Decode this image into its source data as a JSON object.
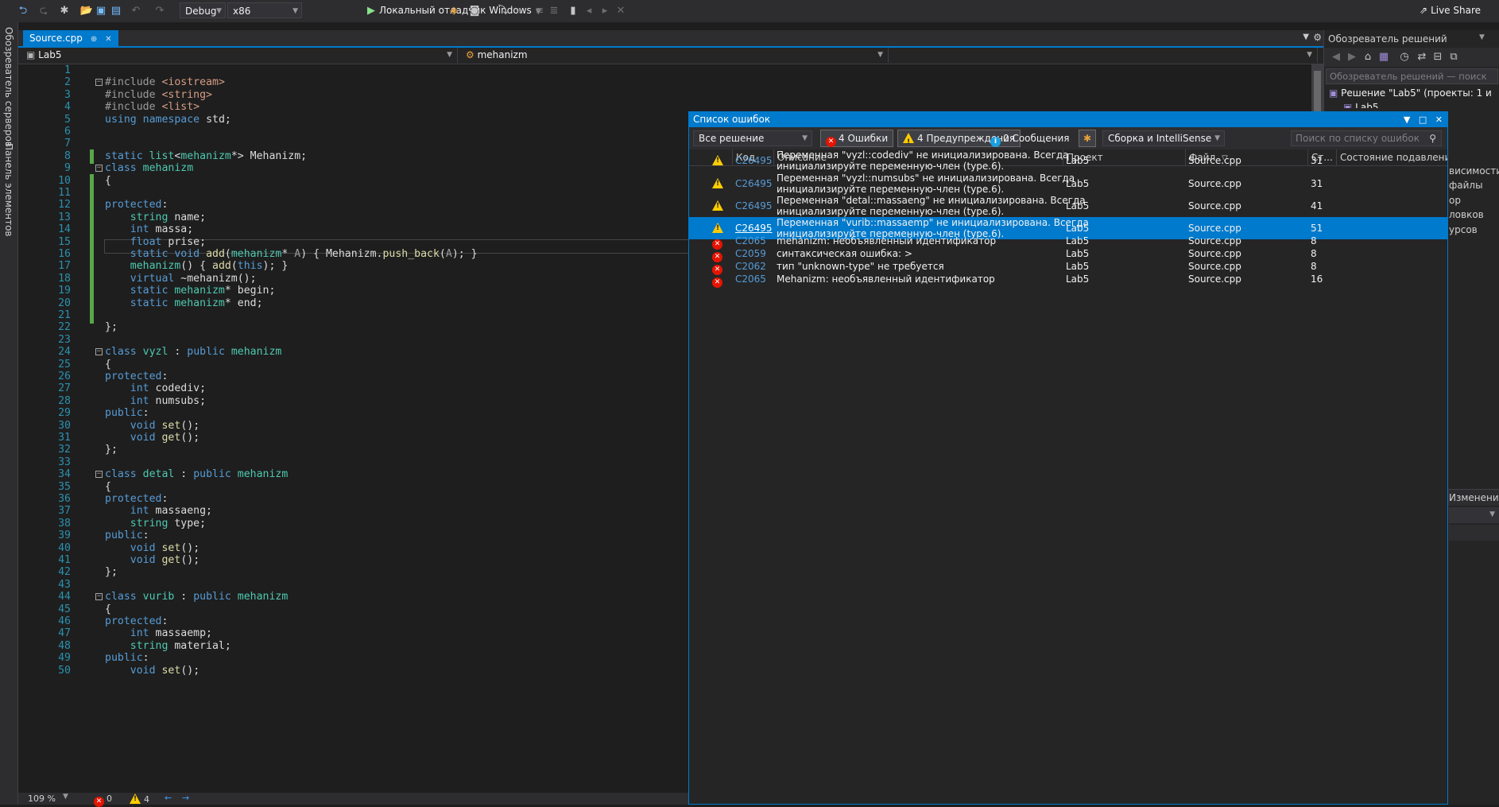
{
  "toolbar": {
    "configuration": "Debug",
    "platform": "x86",
    "run_label": "Локальный отладчик Windows",
    "live_share": "Live Share"
  },
  "left_strip": {
    "server_explorer": "Обозреватель серверов",
    "toolbox": "Панель элементов"
  },
  "editor": {
    "tab_title": "Source.cpp",
    "project_scope": "Lab5",
    "member_scope": "mehanizm",
    "zoom": "109 %",
    "error_count": "0",
    "warning_count": "4",
    "lines": [
      {
        "n": "1",
        "t": ""
      },
      {
        "n": "2",
        "t": "#include <iostream>"
      },
      {
        "n": "3",
        "t": "#include <string>"
      },
      {
        "n": "4",
        "t": "#include <list>"
      },
      {
        "n": "5",
        "t": "using namespace std;"
      },
      {
        "n": "6",
        "t": ""
      },
      {
        "n": "7",
        "t": ""
      },
      {
        "n": "8",
        "t": "static list<mehanizm*> Mehanizm;"
      },
      {
        "n": "9",
        "t": "class mehanizm"
      },
      {
        "n": "10",
        "t": "{"
      },
      {
        "n": "11",
        "t": ""
      },
      {
        "n": "12",
        "t": "protected:"
      },
      {
        "n": "13",
        "t": "    string name;"
      },
      {
        "n": "14",
        "t": "    int massa;"
      },
      {
        "n": "15",
        "t": "    float prise;"
      },
      {
        "n": "16",
        "t": "    static void add(mehanizm* A) { Mehanizm.push_back(A); }"
      },
      {
        "n": "17",
        "t": "    mehanizm() { add(this); }"
      },
      {
        "n": "18",
        "t": "    virtual ~mehanizm();"
      },
      {
        "n": "19",
        "t": "    static mehanizm* begin;"
      },
      {
        "n": "20",
        "t": "    static mehanizm* end;"
      },
      {
        "n": "21",
        "t": ""
      },
      {
        "n": "22",
        "t": "};"
      },
      {
        "n": "23",
        "t": ""
      },
      {
        "n": "24",
        "t": "class vyzl : public mehanizm"
      },
      {
        "n": "25",
        "t": "{"
      },
      {
        "n": "26",
        "t": "protected:"
      },
      {
        "n": "27",
        "t": "    int codediv;"
      },
      {
        "n": "28",
        "t": "    int numsubs;"
      },
      {
        "n": "29",
        "t": "public:"
      },
      {
        "n": "30",
        "t": "    void set();"
      },
      {
        "n": "31",
        "t": "    void get();"
      },
      {
        "n": "32",
        "t": "};"
      },
      {
        "n": "33",
        "t": ""
      },
      {
        "n": "34",
        "t": "class detal : public mehanizm"
      },
      {
        "n": "35",
        "t": "{"
      },
      {
        "n": "36",
        "t": "protected:"
      },
      {
        "n": "37",
        "t": "    int massaeng;"
      },
      {
        "n": "38",
        "t": "    string type;"
      },
      {
        "n": "39",
        "t": "public:"
      },
      {
        "n": "40",
        "t": "    void set();"
      },
      {
        "n": "41",
        "t": "    void get();"
      },
      {
        "n": "42",
        "t": "};"
      },
      {
        "n": "43",
        "t": ""
      },
      {
        "n": "44",
        "t": "class vurib : public mehanizm"
      },
      {
        "n": "45",
        "t": "{"
      },
      {
        "n": "46",
        "t": "protected:"
      },
      {
        "n": "47",
        "t": "    int massaemp;"
      },
      {
        "n": "48",
        "t": "    string material;"
      },
      {
        "n": "49",
        "t": "public:"
      },
      {
        "n": "50",
        "t": "    void set();"
      }
    ]
  },
  "solution_explorer": {
    "title": "Обозреватель решений",
    "search_placeholder": "Обозреватель решений — поиск",
    "root": "Решение \"Lab5\" (проекты: 1 и",
    "project": "Lab5",
    "partial_items": [
      "висимости",
      "файлы",
      "ор",
      "ловков",
      "урсов"
    ],
    "changes": "Изменения"
  },
  "error_list": {
    "title": "Список ошибок",
    "scope": "Все решение",
    "errors_filter": "4 Ошибки",
    "warnings_filter": "4 Предупреждения",
    "messages_filter": "0 Сообщения",
    "source": "Сборка и IntelliSense",
    "search_placeholder": "Поиск по списку ошибок",
    "columns": {
      "code": "Код",
      "description": "Описание",
      "project": "Проект",
      "file": "Файл",
      "line": "Ст...",
      "suppression": "Состояние подавлени"
    },
    "rows": [
      {
        "kind": "warning",
        "code": "C26495",
        "desc1": "Переменная \"vyzl::codediv\" не инициализирована. Всегда",
        "desc2": "инициализируйте переменную-член (type.6).",
        "project": "Lab5",
        "file": "Source.cpp",
        "line": "31"
      },
      {
        "kind": "warning",
        "code": "C26495",
        "desc1": "Переменная \"vyzl::numsubs\" не инициализирована. Всегда",
        "desc2": "инициализируйте переменную-член (type.6).",
        "project": "Lab5",
        "file": "Source.cpp",
        "line": "31"
      },
      {
        "kind": "warning",
        "code": "C26495",
        "desc1": "Переменная \"detal::massaeng\" не инициализирована. Всегда",
        "desc2": "инициализируйте переменную-член (type.6).",
        "project": "Lab5",
        "file": "Source.cpp",
        "line": "41"
      },
      {
        "kind": "warning",
        "code": "C26495",
        "desc1": "Переменная \"vurib::massaemp\" не инициализирована. Всегда",
        "desc2": "инициализируйте переменную-член (type.6).",
        "project": "Lab5",
        "file": "Source.cpp",
        "line": "51",
        "selected": true
      },
      {
        "kind": "error",
        "code": "C2065",
        "desc1": "mehanizm: необъявленный идентификатор",
        "desc2": "",
        "project": "Lab5",
        "file": "Source.cpp",
        "line": "8"
      },
      {
        "kind": "error",
        "code": "C2059",
        "desc1": "синтаксическая ошибка: >",
        "desc2": "",
        "project": "Lab5",
        "file": "Source.cpp",
        "line": "8"
      },
      {
        "kind": "error",
        "code": "C2062",
        "desc1": "тип \"unknown-type\" не требуется",
        "desc2": "",
        "project": "Lab5",
        "file": "Source.cpp",
        "line": "8"
      },
      {
        "kind": "error",
        "code": "C2065",
        "desc1": "Mehanizm: необъявленный идентификатор",
        "desc2": "",
        "project": "Lab5",
        "file": "Source.cpp",
        "line": "16"
      }
    ]
  }
}
